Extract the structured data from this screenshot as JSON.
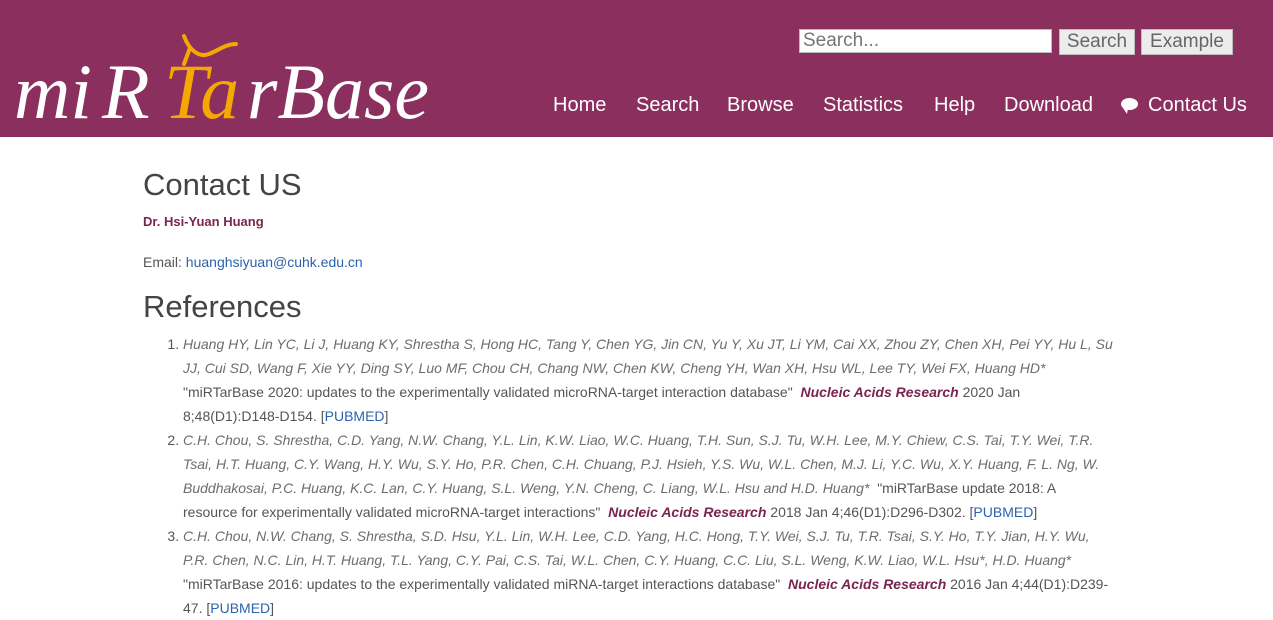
{
  "brand": {
    "logo_text": "miRTarBase",
    "logo_color_main": "#ffffff",
    "logo_color_accent": "#f5a800"
  },
  "header": {
    "search_placeholder": "Search...",
    "search_button": "Search",
    "example_button": "Example",
    "nav": {
      "home": "Home",
      "search": "Search",
      "browse": "Browse",
      "statistics": "Statistics",
      "help": "Help",
      "download": "Download",
      "contact": "Contact Us"
    }
  },
  "contact": {
    "title": "Contact US",
    "name": "Dr. Hsi-Yuan Huang",
    "email_label": "Email:",
    "email": "huanghsiyuan@cuhk.edu.cn"
  },
  "references": {
    "title": "References",
    "items": [
      {
        "authors": "Huang HY, Lin YC, Li J, Huang KY, Shrestha S, Hong HC, Tang Y, Chen YG, Jin CN, Yu Y, Xu JT, Li YM, Cai XX, Zhou ZY, Chen XH, Pei YY, Hu L, Su JJ, Cui SD, Wang F, Xie YY, Ding SY, Luo MF, Chou CH, Chang NW, Chen KW, Cheng YH, Wan XH, Hsu WL, Lee TY, Wei FX, Huang HD*",
        "title": "\"miRTarBase 2020: updates to the experimentally validated microRNA-target interaction database\"",
        "journal": "Nucleic Acids Research",
        "citation": "2020 Jan 8;48(D1):D148-D154.",
        "link": "PUBMED"
      },
      {
        "authors": "C.H. Chou, S. Shrestha, C.D. Yang, N.W. Chang, Y.L. Lin, K.W. Liao, W.C. Huang, T.H. Sun, S.J. Tu, W.H. Lee, M.Y. Chiew, C.S. Tai, T.Y. Wei, T.R. Tsai, H.T. Huang, C.Y. Wang, H.Y. Wu, S.Y. Ho, P.R. Chen, C.H. Chuang, P.J. Hsieh, Y.S. Wu, W.L. Chen, M.J. Li, Y.C. Wu, X.Y. Huang, F. L. Ng, W. Buddhakosai, P.C. Huang, K.C. Lan, C.Y. Huang, S.L. Weng, Y.N. Cheng, C. Liang, W.L. Hsu and H.D. Huang*",
        "title": "\"miRTarBase update 2018: A resource for experimentally validated microRNA-target interactions\"",
        "journal": "Nucleic Acids Research",
        "citation": "2018 Jan 4;46(D1):D296-D302.",
        "link": "PUBMED"
      },
      {
        "authors": "C.H. Chou, N.W. Chang, S. Shrestha, S.D. Hsu, Y.L. Lin, W.H. Lee, C.D. Yang, H.C. Hong, T.Y. Wei, S.J. Tu, T.R. Tsai, S.Y. Ho, T.Y. Jian, H.Y. Wu, P.R. Chen, N.C. Lin, H.T. Huang, T.L. Yang, C.Y. Pai, C.S. Tai, W.L. Chen, C.Y. Huang, C.C. Liu, S.L. Weng, K.W. Liao, W.L. Hsu*, H.D. Huang*",
        "title": "\"miRTarBase 2016: updates to the experimentally validated miRNA-target interactions database\"",
        "journal": "Nucleic Acids Research",
        "citation": "2016 Jan 4;44(D1):D239-47.",
        "link": "PUBMED"
      }
    ]
  }
}
